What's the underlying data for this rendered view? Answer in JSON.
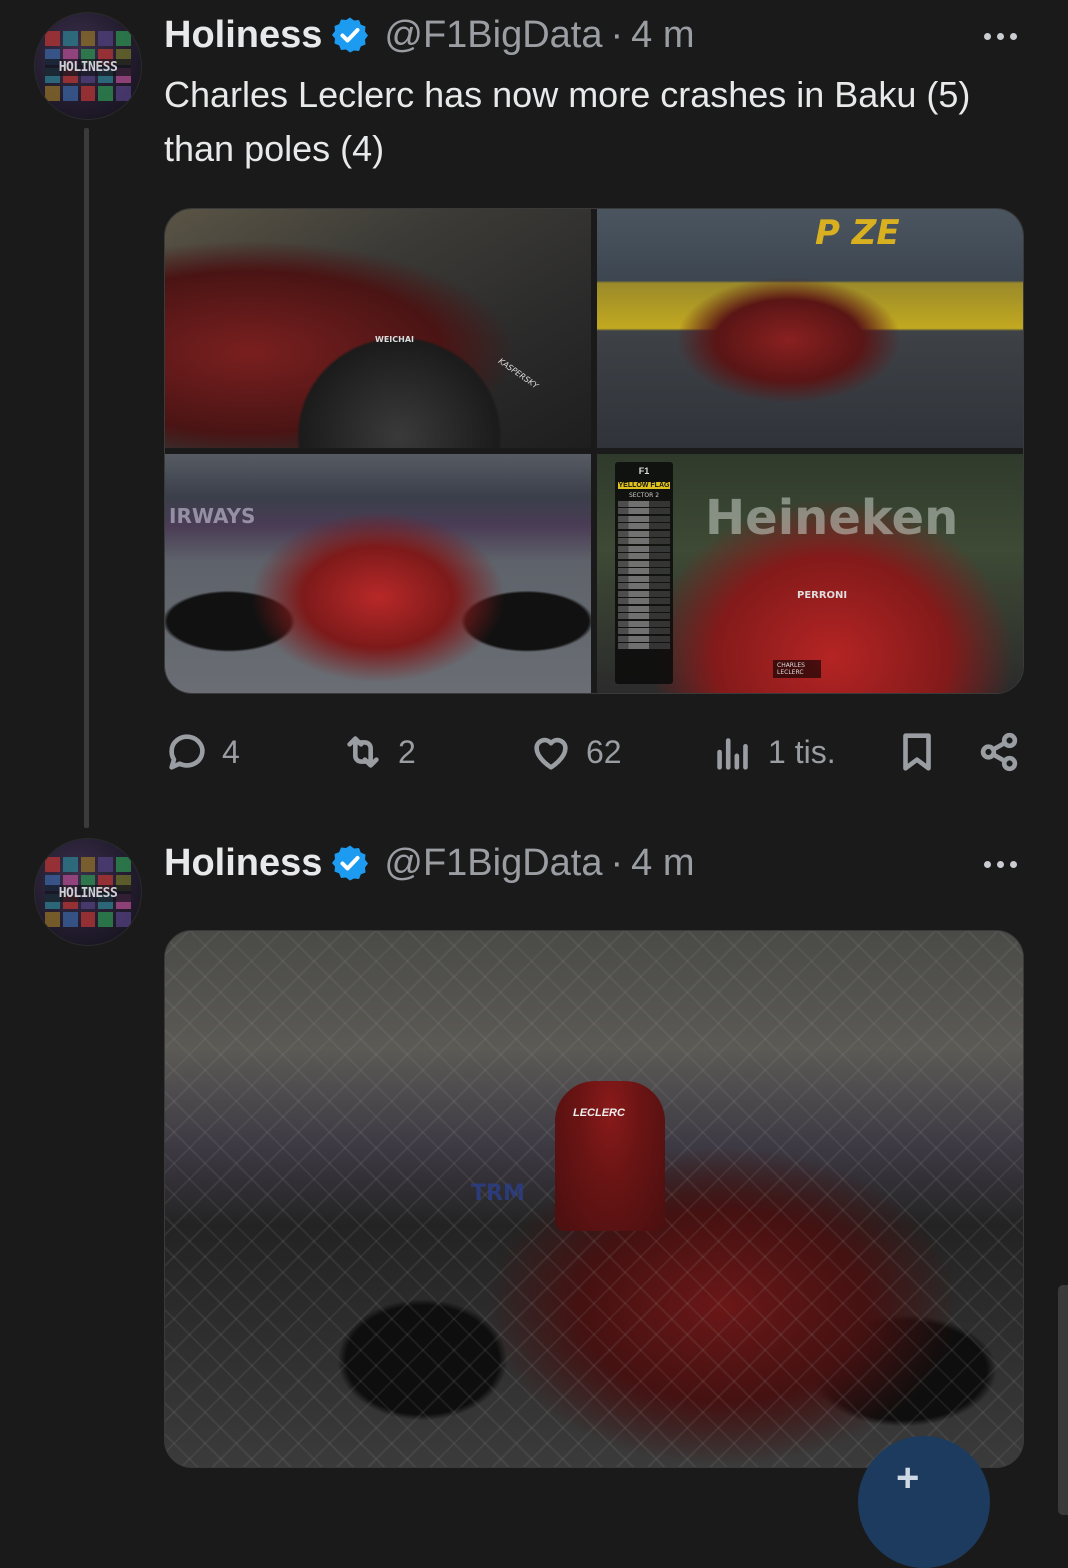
{
  "tweet1": {
    "author_name": "Holiness",
    "handle": "@F1BigData",
    "separator": "·",
    "time": "4 m",
    "avatar_text": "HOLINESS",
    "text": "Charles Leclerc has now more crashes in Baku (5) than poles (4)",
    "media": {
      "p1_halo": "WEICHAI",
      "p1_halo_right": "KASPERSKY",
      "p2_sign": "P ZE",
      "p3_banner": "IRWAYS",
      "p4_banner": "Heineken",
      "p4_halo": "PERRONI",
      "tower_brand": "F1",
      "tower_flag": "YELLOW FLAG",
      "tower_sector": "SECTOR 2",
      "tower_driver": "CHARLES LECLERC"
    },
    "stats": {
      "replies": "4",
      "reposts": "2",
      "likes": "62",
      "views": "1 tis."
    }
  },
  "tweet2": {
    "author_name": "Holiness",
    "handle": "@F1BigData",
    "separator": "·",
    "time": "4 m",
    "avatar_text": "HOLINESS",
    "media": {
      "suit_name": "LECLERC",
      "wing_text": "TRM"
    }
  },
  "fab": {
    "glyph": "+"
  },
  "colors": {
    "background": "#1a1a1a",
    "text": "#e7e9ea",
    "secondary": "#9a9ea3",
    "verified": "#1d9bf0",
    "ferrari_red": "#b82828"
  }
}
